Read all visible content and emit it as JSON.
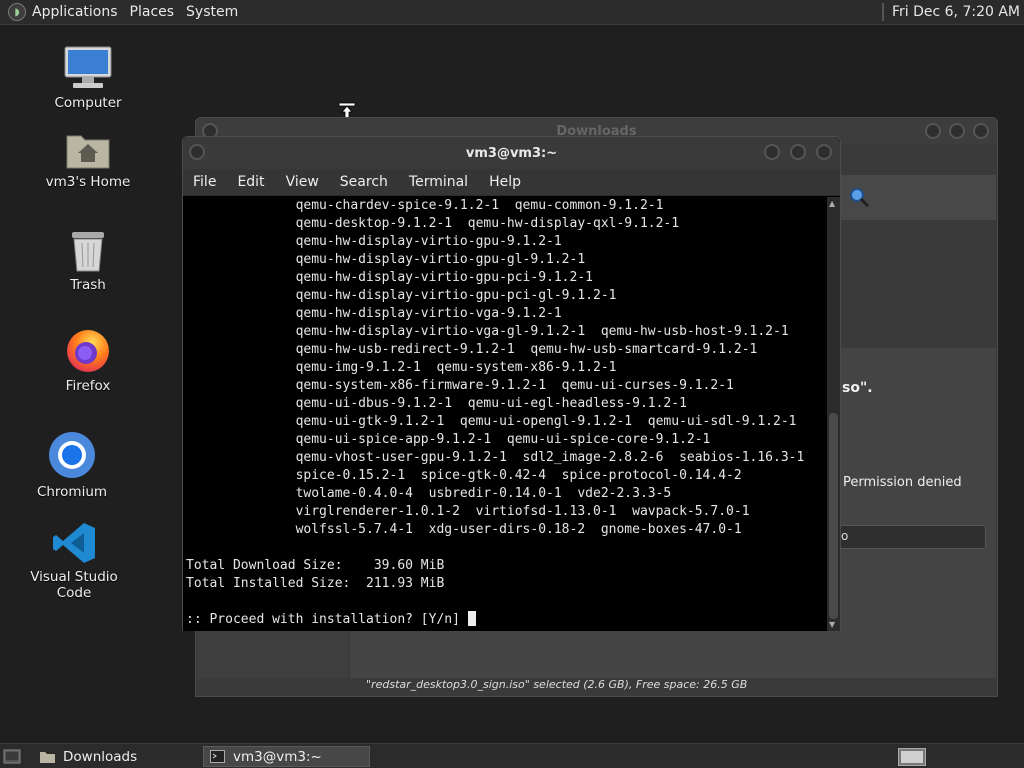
{
  "top_panel": {
    "menus": [
      "Applications",
      "Places",
      "System"
    ],
    "clock": "Fri Dec 6, 7:20 AM"
  },
  "desktop_icons": [
    {
      "label": "Computer",
      "icon": "computer-icon"
    },
    {
      "label": "vm3's Home",
      "icon": "home-folder-icon"
    },
    {
      "label": "Trash",
      "icon": "trash-icon"
    },
    {
      "label": "Firefox",
      "icon": "firefox-icon"
    },
    {
      "label": "Chromium",
      "icon": "chromium-icon"
    },
    {
      "label": "Visual Studio Code",
      "icon": "vscode-icon"
    }
  ],
  "downloads_window": {
    "title": "Downloads",
    "fragment_1": "so\".",
    "fragment_2": "Permission denied",
    "button_fragment": "o",
    "status": "\"redstar_desktop3.0_sign.iso\" selected (2.6 GB), Free space: 26.5 GB"
  },
  "terminal": {
    "title": "vm3@vm3:~",
    "menu": [
      "File",
      "Edit",
      "View",
      "Search",
      "Terminal",
      "Help"
    ],
    "lines": [
      "              qemu-chardev-spice-9.1.2-1  qemu-common-9.1.2-1",
      "              qemu-desktop-9.1.2-1  qemu-hw-display-qxl-9.1.2-1",
      "              qemu-hw-display-virtio-gpu-9.1.2-1",
      "              qemu-hw-display-virtio-gpu-gl-9.1.2-1",
      "              qemu-hw-display-virtio-gpu-pci-9.1.2-1",
      "              qemu-hw-display-virtio-gpu-pci-gl-9.1.2-1",
      "              qemu-hw-display-virtio-vga-9.1.2-1",
      "              qemu-hw-display-virtio-vga-gl-9.1.2-1  qemu-hw-usb-host-9.1.2-1",
      "              qemu-hw-usb-redirect-9.1.2-1  qemu-hw-usb-smartcard-9.1.2-1",
      "              qemu-img-9.1.2-1  qemu-system-x86-9.1.2-1",
      "              qemu-system-x86-firmware-9.1.2-1  qemu-ui-curses-9.1.2-1",
      "              qemu-ui-dbus-9.1.2-1  qemu-ui-egl-headless-9.1.2-1",
      "              qemu-ui-gtk-9.1.2-1  qemu-ui-opengl-9.1.2-1  qemu-ui-sdl-9.1.2-1",
      "              qemu-ui-spice-app-9.1.2-1  qemu-ui-spice-core-9.1.2-1",
      "              qemu-vhost-user-gpu-9.1.2-1  sdl2_image-2.8.2-6  seabios-1.16.3-1",
      "              spice-0.15.2-1  spice-gtk-0.42-4  spice-protocol-0.14.4-2",
      "              twolame-0.4.0-4  usbredir-0.14.0-1  vde2-2.3.3-5",
      "              virglrenderer-1.0.1-2  virtiofsd-1.13.0-1  wavpack-5.7.0-1",
      "              wolfssl-5.7.4-1  xdg-user-dirs-0.18-2  gnome-boxes-47.0-1",
      "",
      "Total Download Size:    39.60 MiB",
      "Total Installed Size:  211.93 MiB",
      ""
    ],
    "prompt": ":: Proceed with installation? [Y/n] "
  },
  "taskbar": {
    "items": [
      {
        "label": "Downloads",
        "active": false
      },
      {
        "label": "vm3@vm3:~",
        "active": true
      }
    ]
  }
}
